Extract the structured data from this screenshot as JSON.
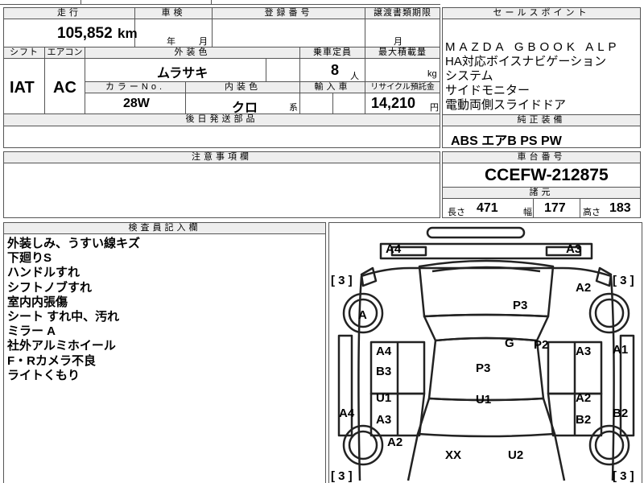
{
  "top_partial": "",
  "header": {
    "mileage_label": "走行",
    "mileage_value": "105,852",
    "mileage_unit": "km",
    "inspection_label": "車検",
    "inspection_year_unit": "年",
    "inspection_month_unit": "月",
    "registration_label": "登録番号",
    "transfer_deadline_label": "譲渡書類期限",
    "transfer_month_unit": "月"
  },
  "specs": {
    "shift_label": "シフト",
    "shift_value": "IAT",
    "aircon_label": "エアコン",
    "aircon_value": "AC",
    "exterior_color_label": "外装色",
    "exterior_color_value": "ムラサキ",
    "capacity_label": "乗車定員",
    "capacity_value": "8",
    "capacity_unit": "人",
    "max_load_label": "最大積載量",
    "max_load_unit": "kg",
    "color_no_label": "カラーNo.",
    "color_no_value": "28W",
    "interior_color_label": "内装色",
    "interior_color_value": "クロ",
    "interior_color_suffix": "系",
    "import_label": "輸入車",
    "recycle_label": "リサイクル預託金",
    "recycle_value": "14,210",
    "recycle_unit": "円",
    "later_parts_label": "後日発送部品"
  },
  "sales_point": {
    "label": "セールスポイント",
    "lines": [
      "MAZDA GBOOK ALP",
      "HA対応ボイスナビゲーション",
      "システム",
      "サイドモニター",
      "電動両側スライドドア"
    ]
  },
  "standard_equipment": {
    "label": "純正装備",
    "value": "ABS エアB PS PW"
  },
  "notes": {
    "label": "注意事項欄"
  },
  "chassis": {
    "label": "車台番号",
    "value": "CCEFW-212875"
  },
  "dimensions": {
    "label": "諸元",
    "length_label": "長さ",
    "length_value": "471",
    "width_label": "幅",
    "width_value": "177",
    "height_label": "高さ",
    "height_value": "183"
  },
  "inspector": {
    "label": "検査員記入欄",
    "lines": [
      "外装しみ、うすい線キズ",
      "下廻りS",
      "ハンドルすれ",
      "シフトノブすれ",
      "室内内張傷",
      "シート すれ中、汚れ",
      "ミラー A",
      "社外アルミホイール",
      "F・Rカメラ不良",
      "ライトくもり"
    ]
  },
  "diagram": {
    "codes": {
      "front_left": "A4",
      "front_right": "A3",
      "fl_tire_tread": "3",
      "fr_tire_tread": "3",
      "fl_wheel": "A",
      "right_front_fender": "A2",
      "hood": "P3",
      "windshield": "G",
      "right_pillar": "P2",
      "left_front_door_1": "A4",
      "left_front_door_2": "B3",
      "right_front_door": "A3",
      "right_side_panel": "A1",
      "roof": "P3",
      "left_rear_door_1": "U1",
      "left_rear_door_2": "A3",
      "right_rear_door_1": "A2",
      "right_rear_door_2": "B2",
      "left_rocker": "A4",
      "right_rocker": "B2",
      "interior": "U1",
      "left_rear_fender": "A2",
      "rear_left": "XX",
      "rear_right": "U2",
      "rl_tire_tread": "3",
      "rr_tire_tread": "3"
    }
  }
}
